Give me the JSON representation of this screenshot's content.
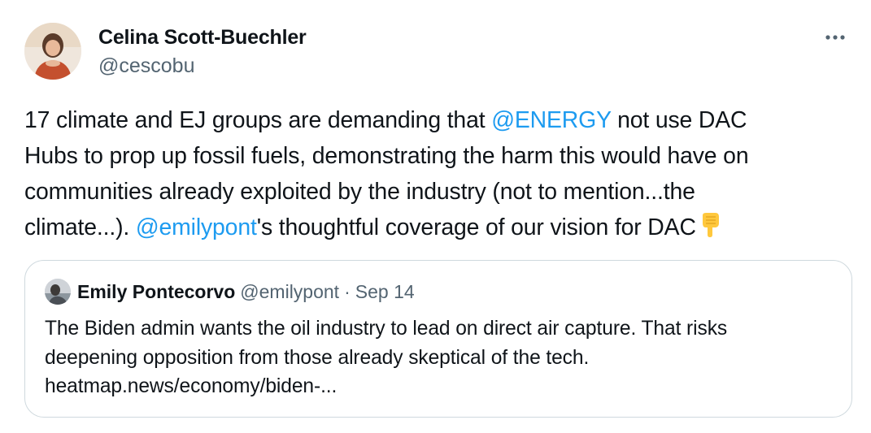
{
  "author": {
    "name": "Celina Scott-Buechler",
    "handle": "@cescobu",
    "avatar_icon": "profile-photo"
  },
  "more_icon": "more-options-icon",
  "tweet": {
    "line1": {
      "pre": "17 climate and EJ groups are demanding that ",
      "mention": "@ENERGY",
      "post": " not use DAC"
    },
    "line2": "Hubs to prop up fossil fuels, demonstrating the harm this would have on",
    "line3": "communities already exploited by the industry (not to mention...the",
    "line4": {
      "pre": "climate...). ",
      "mention": "@emilypont",
      "post": "'s thoughtful coverage of our vision for DAC"
    },
    "emoji": "backhand-index-pointing-down"
  },
  "quoted": {
    "name": "Emily Pontecorvo",
    "handle": "@emilypont",
    "separator": "·",
    "date": "Sep 14",
    "lines": [
      "The Biden admin wants the oil industry to lead on direct air capture. That risks",
      "deepening opposition from those already skeptical of the tech.",
      "heatmap.news/economy/biden-..."
    ]
  },
  "colors": {
    "text": "#0f1419",
    "secondary": "#536471",
    "link": "#1d9bf0",
    "border": "#cfd9de"
  }
}
